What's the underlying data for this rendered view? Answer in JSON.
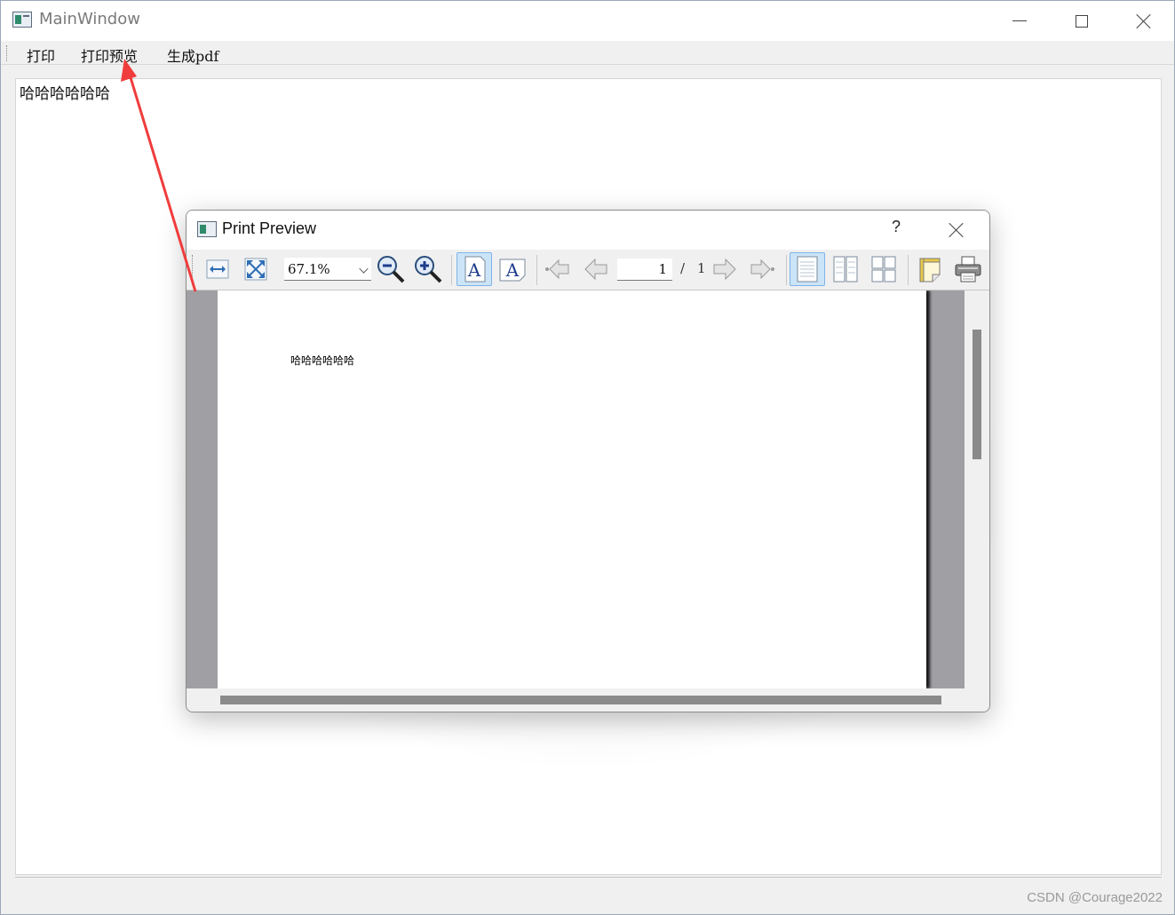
{
  "main_window": {
    "title": "MainWindow",
    "menu": {
      "print": "打印",
      "print_preview": "打印预览",
      "generate_pdf": "生成pdf"
    },
    "content_text": "哈哈哈哈哈哈"
  },
  "dialog": {
    "title": "Print Preview",
    "help": "?",
    "zoom": "67.1%",
    "current_page": "1",
    "page_separator": "/",
    "total_pages": "1",
    "page_text": "哈哈哈哈哈哈"
  },
  "watermark": "CSDN @Courage2022",
  "colors": {
    "annotation_arrow": "#f03c3c",
    "preview_background": "#a0a0a4",
    "active_button": "#cce4f7"
  }
}
